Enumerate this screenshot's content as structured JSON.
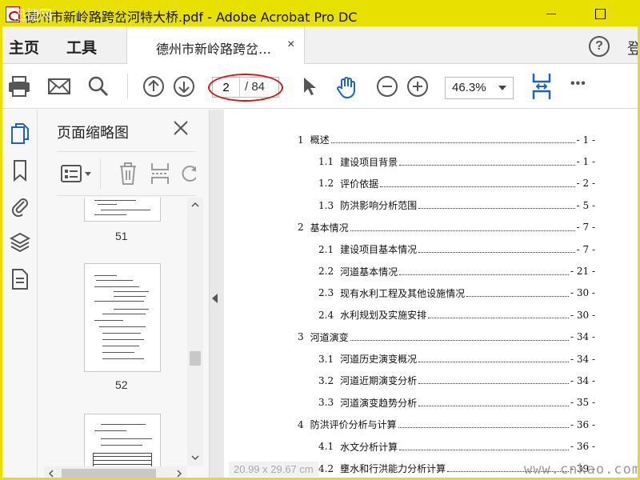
{
  "titlebar": {
    "title": "德州市新岭路跨岔河特大桥.pdf - Adobe Acrobat Pro DC",
    "watermark": "迅捷网"
  },
  "menu": {
    "home": "主页",
    "tools": "工具",
    "signin": "登"
  },
  "tab": {
    "label": "德州市新岭路跨岔…",
    "close": "×"
  },
  "help": "?",
  "toolbar": {
    "current_page": "2",
    "total_pages": "/ 84",
    "zoom": "46.3%",
    "more": "•••",
    "highlight_color": "#d21a1a",
    "icon_color": "#1a63c8"
  },
  "panel": {
    "title": "页面缩略图",
    "thumbnails": [
      {
        "label": "51"
      },
      {
        "label": "52"
      }
    ]
  },
  "toc": [
    {
      "level": 1,
      "num": "1",
      "text": "概述",
      "page": "- 1 -"
    },
    {
      "level": 2,
      "num": "1.1",
      "text": "建设项目背景",
      "page": "- 1 -"
    },
    {
      "level": 2,
      "num": "1.2",
      "text": "评价依据",
      "page": "- 2 -"
    },
    {
      "level": 2,
      "num": "1.3",
      "text": "防洪影响分析范围",
      "page": "- 5 -"
    },
    {
      "level": 1,
      "num": "2",
      "text": "基本情况",
      "page": "- 7 -"
    },
    {
      "level": 2,
      "num": "2.1",
      "text": "建设项目基本情况",
      "page": "- 7 -"
    },
    {
      "level": 2,
      "num": "2.2",
      "text": "河道基本情况",
      "page": "- 21 -"
    },
    {
      "level": 2,
      "num": "2.3",
      "text": "现有水利工程及其他设施情况",
      "page": "- 30 -"
    },
    {
      "level": 2,
      "num": "2.4",
      "text": "水利规划及实施安排",
      "page": "- 30 -"
    },
    {
      "level": 1,
      "num": "3",
      "text": "河道演变",
      "page": "- 34 -"
    },
    {
      "level": 2,
      "num": "3.1",
      "text": "河道历史演变概况",
      "page": "- 34 -"
    },
    {
      "level": 2,
      "num": "3.2",
      "text": "河道近期演变分析",
      "page": "- 34 -"
    },
    {
      "level": 2,
      "num": "3.3",
      "text": "河道演变趋势分析",
      "page": "- 35 -"
    },
    {
      "level": 1,
      "num": "4",
      "text": "防洪评价分析与计算",
      "page": "- 36 -"
    },
    {
      "level": 2,
      "num": "4.1",
      "text": "水文分析计算",
      "page": "- 36 -"
    },
    {
      "level": 2,
      "num": "4.2",
      "text": "壅水和行洪能力分析计算",
      "page": "- 39 -"
    }
  ],
  "status": {
    "coords": "20.99 x 29.67 cm"
  },
  "sitemark": "www.cnkao.com"
}
